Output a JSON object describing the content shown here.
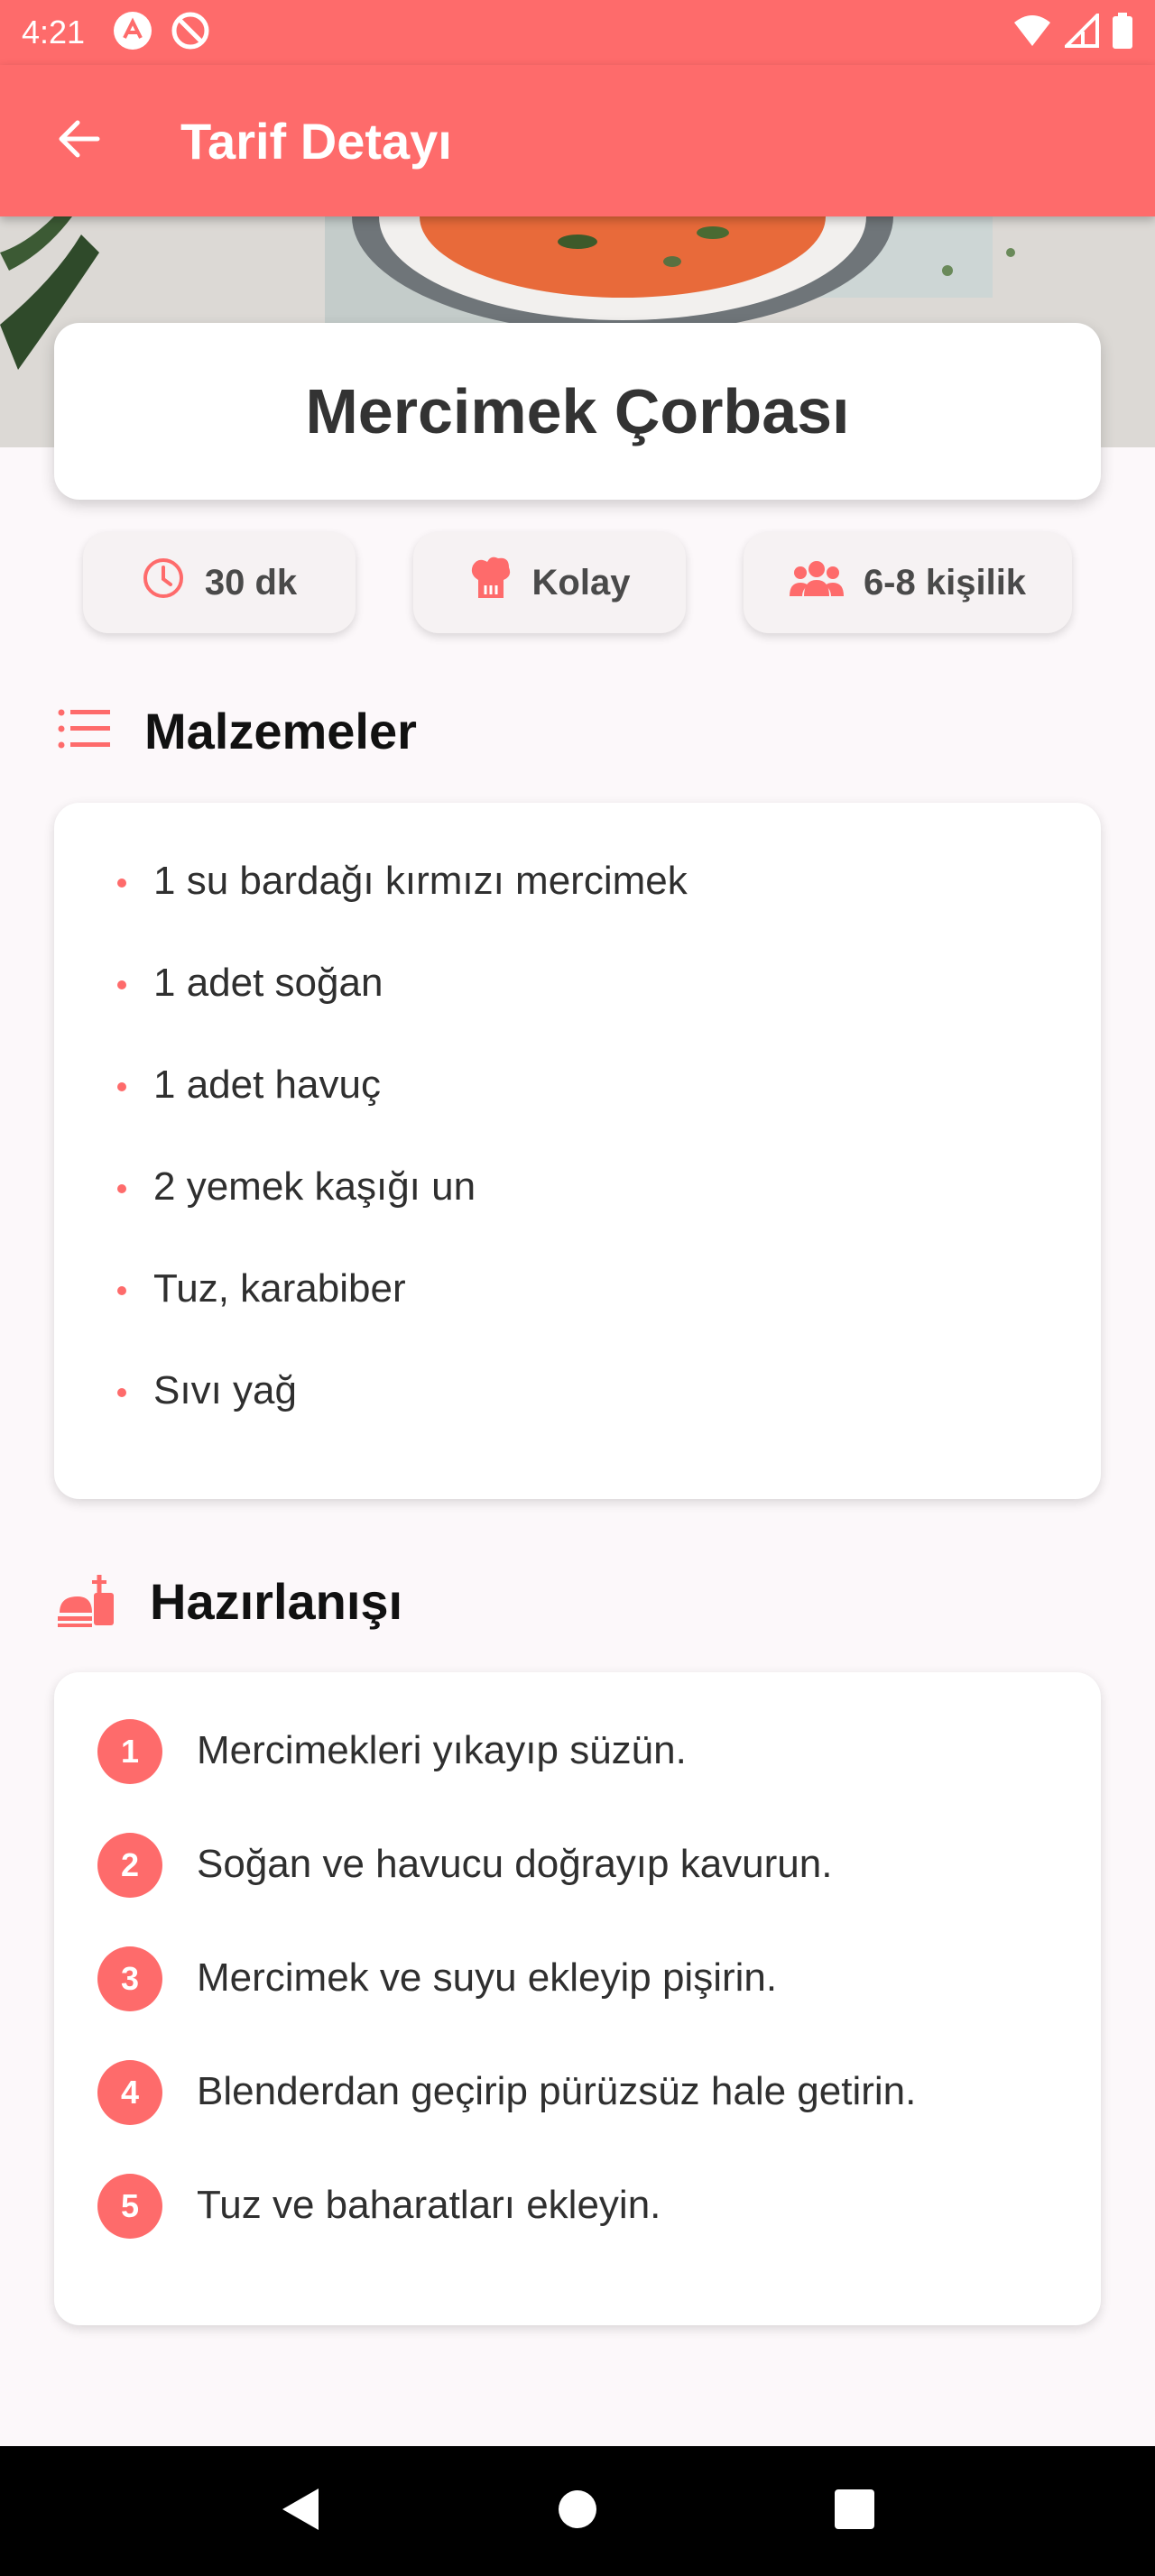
{
  "status_bar": {
    "time": "4:21"
  },
  "app_bar": {
    "title": "Tarif Detayı"
  },
  "recipe": {
    "name": "Mercimek Çorbası"
  },
  "info": {
    "time": "30 dk",
    "difficulty": "Kolay",
    "servings": "6-8 kişilik"
  },
  "ingredients": {
    "title": "Malzemeler",
    "items": [
      "1 su bardağı kırmızı mercimek",
      "1 adet soğan",
      "1 adet havuç",
      "2 yemek kaşığı un",
      "Tuz, karabiber",
      "Sıvı yağ"
    ]
  },
  "preparation": {
    "title": "Hazırlanışı",
    "steps": [
      {
        "number": "1",
        "text": "Mercimekleri yıkayıp süzün."
      },
      {
        "number": "2",
        "text": "Soğan ve havucu doğrayıp kavurun."
      },
      {
        "number": "3",
        "text": "Mercimek ve suyu ekleyip pişirin."
      },
      {
        "number": "4",
        "text": "Blenderdan geçirip pürüzsüz hale getirin."
      },
      {
        "number": "5",
        "text": "Tuz ve baharatları ekleyin."
      }
    ]
  },
  "colors": {
    "accent": "#fe6b6b",
    "background": "#fcf8fa",
    "card": "#ffffff",
    "chip": "#f6f2f3"
  }
}
